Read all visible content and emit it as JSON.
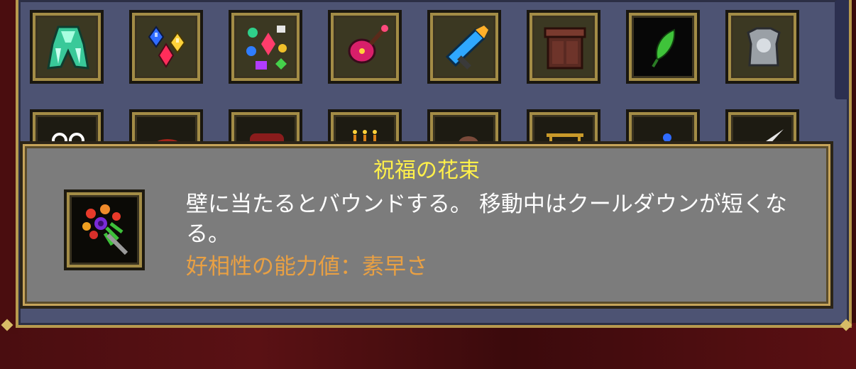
{
  "tooltip": {
    "item_name": "祝福の花束",
    "description": "壁に当たるとバウンドする。 移動中はクールダウンが短くなる。",
    "affinity": "好相性の能力値：素早さ"
  },
  "inventory": {
    "row1": [
      {
        "icon": "green-cape-icon"
      },
      {
        "icon": "gems-icon"
      },
      {
        "icon": "jewel-pile-icon"
      },
      {
        "icon": "red-lute-icon"
      },
      {
        "icon": "blue-wand-icon"
      },
      {
        "icon": "wooden-cabinet-icon"
      },
      {
        "icon": "green-leaf-icon"
      },
      {
        "icon": "silver-armor-icon"
      }
    ],
    "row2": [
      {
        "icon": "skull-mask-icon"
      },
      {
        "icon": "red-creature-icon"
      },
      {
        "icon": "red-chest-icon"
      },
      {
        "icon": "candles-icon"
      },
      {
        "icon": "brown-item-icon"
      },
      {
        "icon": "gold-gate-icon"
      },
      {
        "icon": "blue-orb-icon"
      },
      {
        "icon": "white-blade-icon"
      }
    ]
  },
  "colors": {
    "title": "#fff04a",
    "description": "#ffffff",
    "affinity": "#e9a043",
    "frame_gold": "#c6a45a"
  }
}
